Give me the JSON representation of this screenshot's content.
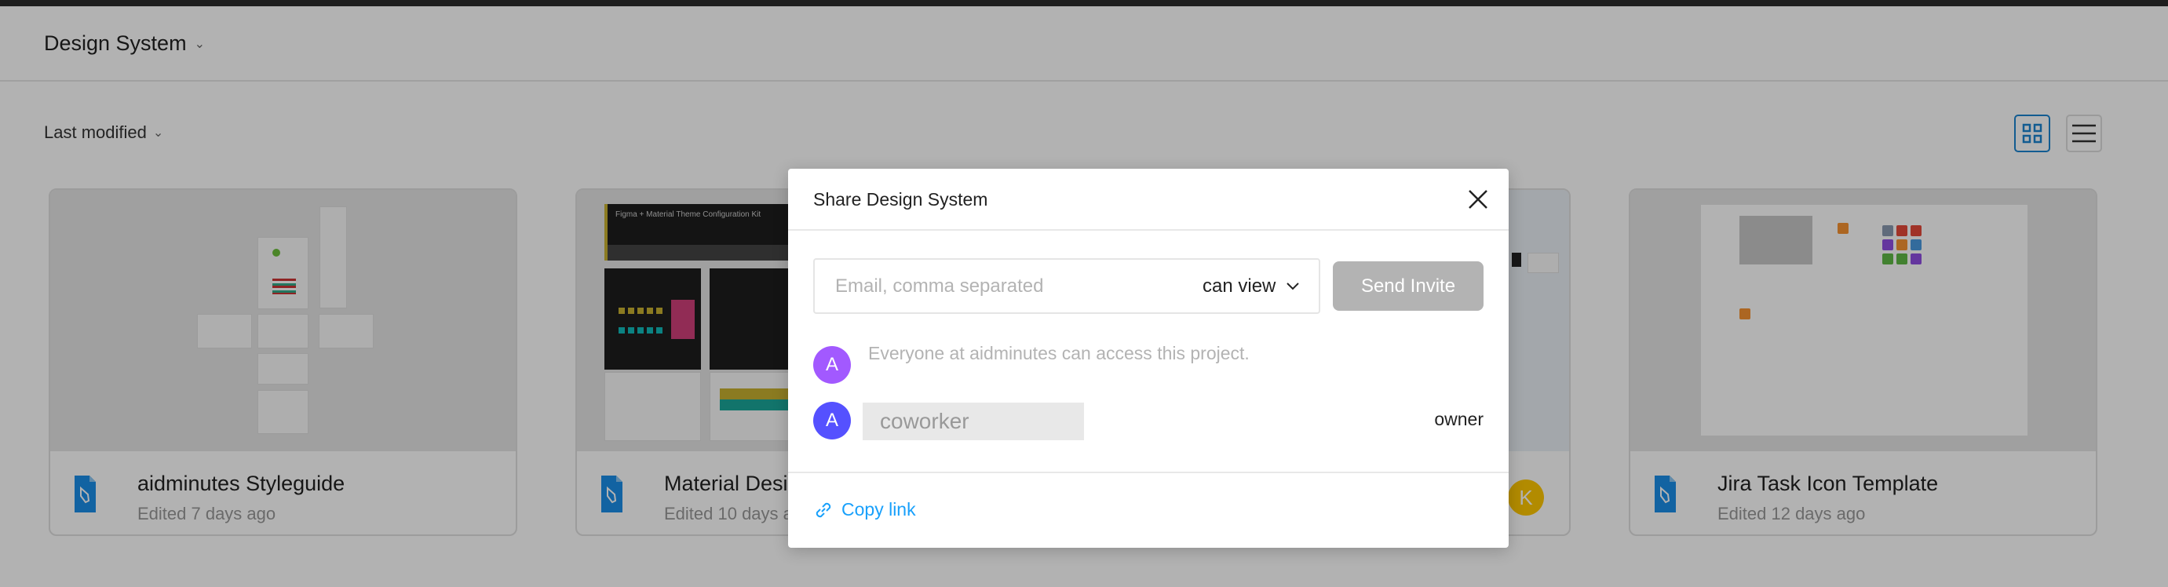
{
  "header": {
    "project_title": "Design System"
  },
  "toolbar": {
    "sort_label": "Last modified",
    "view_modes": [
      "grid",
      "list"
    ],
    "active_view": "grid"
  },
  "files": [
    {
      "title": "aidminutes Styleguide",
      "edited": "Edited 7 days ago"
    },
    {
      "title": "Material Design",
      "edited": "Edited 10 days ago"
    },
    {
      "title": "",
      "edited": "",
      "collaborator_initial": "K"
    },
    {
      "title": "Jira Task Icon Template",
      "edited": "Edited 12 days ago"
    }
  ],
  "thumbnail_text": {
    "material_kit_title": "Figma + Material Theme Configuration Kit"
  },
  "share_dialog": {
    "title": "Share Design System",
    "email_placeholder": "Email, comma separated",
    "permission": "can view",
    "send_label": "Send Invite",
    "org_avatar": "A",
    "org_text": "Everyone at aidminutes can access this project.",
    "member_avatar": "A",
    "member_name": "coworker",
    "member_role": "owner",
    "copy_link_label": "Copy link"
  },
  "colors": {
    "accent": "#18a0fb",
    "org_avatar": "#a259ff",
    "member_avatar": "#5551ff",
    "collaborator_avatar": "#ffc700",
    "file_icon": "#1b8ee8"
  }
}
